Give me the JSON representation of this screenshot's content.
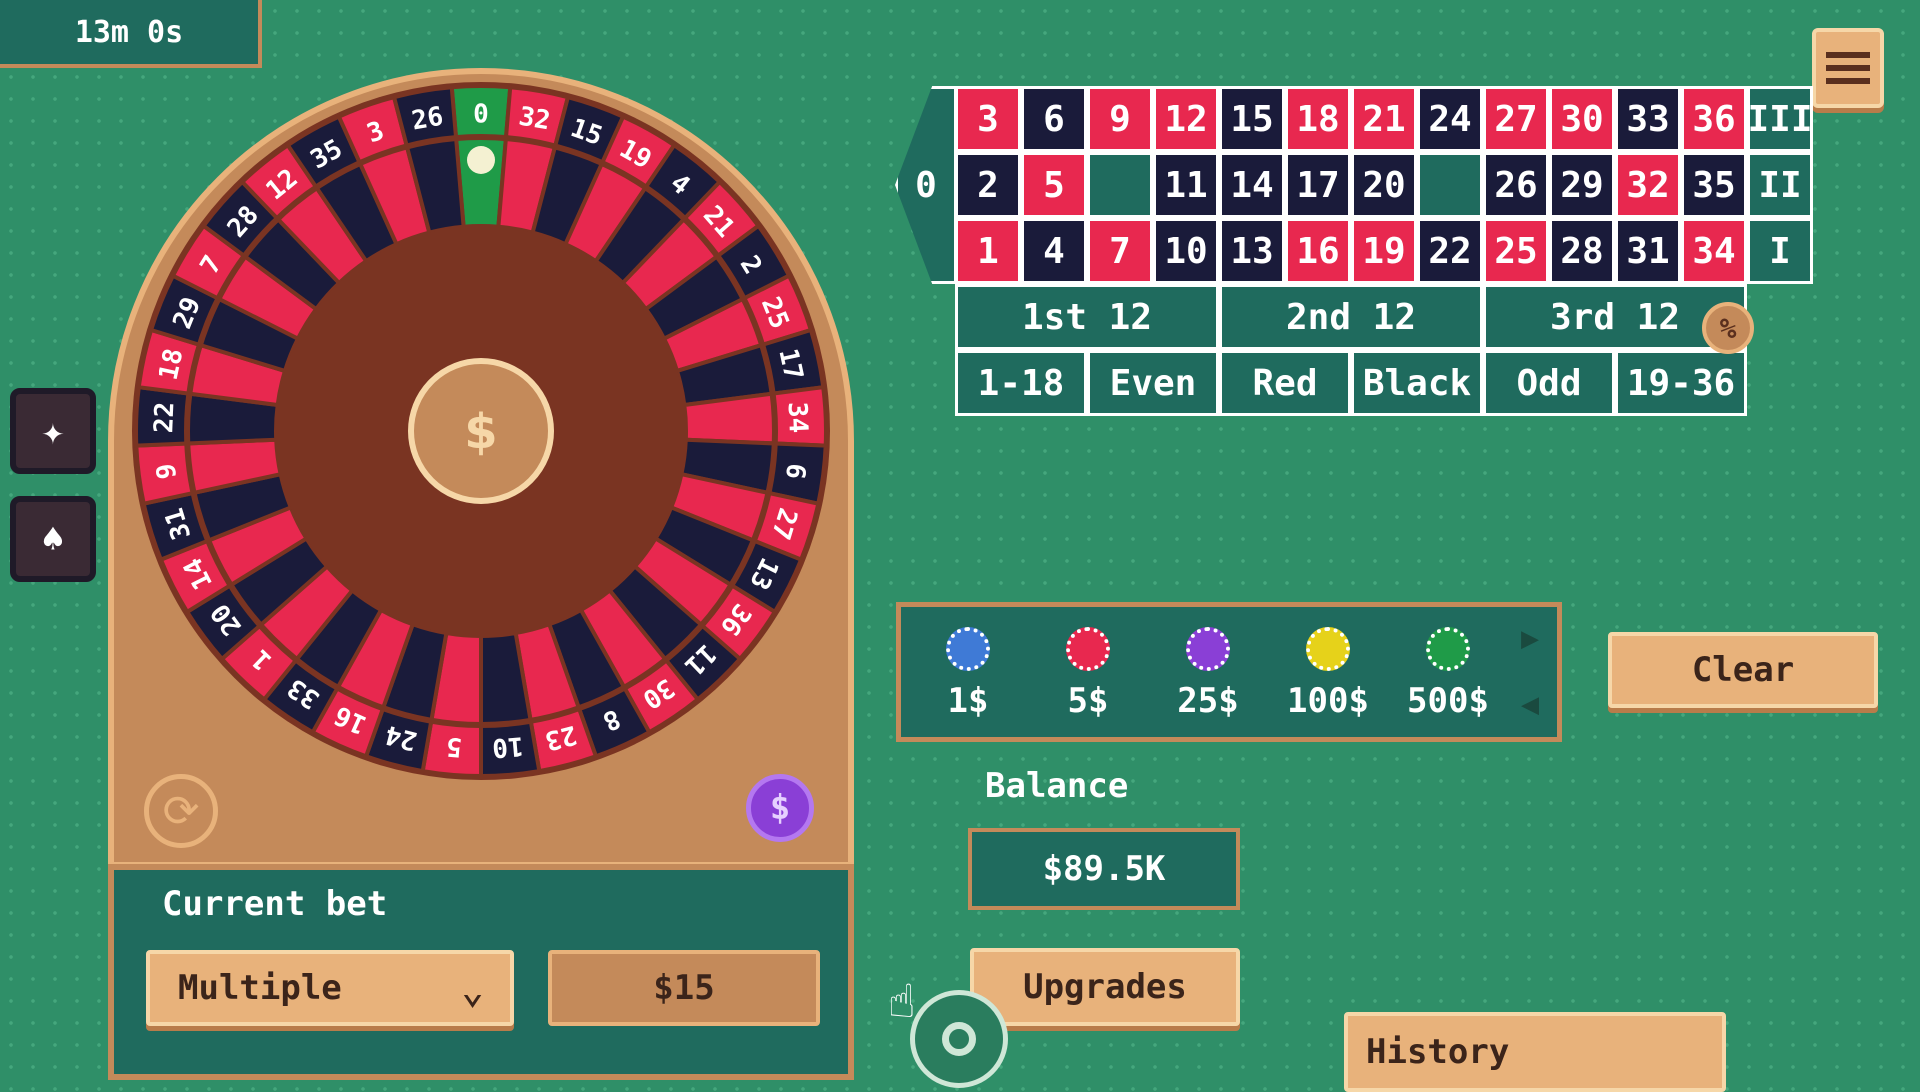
{
  "timer": "13m 0s",
  "wheel": {
    "numbers": [
      "0",
      "32",
      "15",
      "19",
      "4",
      "21",
      "2",
      "25",
      "17",
      "34",
      "6",
      "27",
      "13",
      "36",
      "11",
      "30",
      "8",
      "23",
      "10",
      "5",
      "24",
      "16",
      "33",
      "1",
      "20",
      "14",
      "31",
      "9",
      "22",
      "18",
      "29",
      "7",
      "28",
      "12",
      "35",
      "3",
      "26"
    ],
    "colors": {
      "red": "#e8284f",
      "black": "#1a1b3a",
      "green": "#1f9b48",
      "rim": "#c48a5a",
      "hub": "#7a3422"
    }
  },
  "table": {
    "zero": "0",
    "rows": [
      [
        {
          "n": "3",
          "c": "red"
        },
        {
          "n": "6",
          "c": "black"
        },
        {
          "n": "9",
          "c": "red"
        },
        {
          "n": "12",
          "c": "red"
        },
        {
          "n": "15",
          "c": "black"
        },
        {
          "n": "18",
          "c": "red"
        },
        {
          "n": "21",
          "c": "red"
        },
        {
          "n": "24",
          "c": "black"
        },
        {
          "n": "27",
          "c": "red"
        },
        {
          "n": "30",
          "c": "red"
        },
        {
          "n": "33",
          "c": "black"
        },
        {
          "n": "36",
          "c": "red"
        }
      ],
      [
        {
          "n": "2",
          "c": "black"
        },
        {
          "n": "5",
          "c": "red"
        },
        {
          "n": "",
          "c": "green"
        },
        {
          "n": "11",
          "c": "black"
        },
        {
          "n": "14",
          "c": "black"
        },
        {
          "n": "17",
          "c": "black"
        },
        {
          "n": "20",
          "c": "black"
        },
        {
          "n": "",
          "c": "green"
        },
        {
          "n": "26",
          "c": "black"
        },
        {
          "n": "29",
          "c": "black"
        },
        {
          "n": "32",
          "c": "red"
        },
        {
          "n": "35",
          "c": "black"
        }
      ],
      [
        {
          "n": "1",
          "c": "red"
        },
        {
          "n": "4",
          "c": "black"
        },
        {
          "n": "7",
          "c": "red"
        },
        {
          "n": "10",
          "c": "black"
        },
        {
          "n": "13",
          "c": "black"
        },
        {
          "n": "16",
          "c": "red"
        },
        {
          "n": "19",
          "c": "red"
        },
        {
          "n": "22",
          "c": "black"
        },
        {
          "n": "25",
          "c": "red"
        },
        {
          "n": "28",
          "c": "black"
        },
        {
          "n": "31",
          "c": "black"
        },
        {
          "n": "34",
          "c": "red"
        }
      ]
    ],
    "columns": [
      "III",
      "II",
      "I"
    ],
    "dozens": [
      "1st 12",
      "2nd 12",
      "3rd 12"
    ],
    "outside": [
      "1-18",
      "Even",
      "Red",
      "Black",
      "Odd",
      "19-36"
    ]
  },
  "chips": [
    {
      "label": "1$",
      "color": "#3f7ad6"
    },
    {
      "label": "5$",
      "color": "#e8284f"
    },
    {
      "label": "25$",
      "color": "#8a3fd6"
    },
    {
      "label": "100$",
      "color": "#e6d21a"
    },
    {
      "label": "500$",
      "color": "#1f9b48"
    }
  ],
  "clear_label": "Clear",
  "balance": {
    "label": "Balance",
    "value": "$89.5K"
  },
  "current_bet": {
    "label": "Current bet",
    "mode": "Multiple",
    "amount": "$15"
  },
  "upgrades_label": "Upgrades",
  "history_label": "History",
  "icons": [
    "menu-icon",
    "sparkles-icon",
    "chip-icon",
    "refresh-icon",
    "dollar-icon",
    "percent-icon",
    "pointer-icon"
  ]
}
